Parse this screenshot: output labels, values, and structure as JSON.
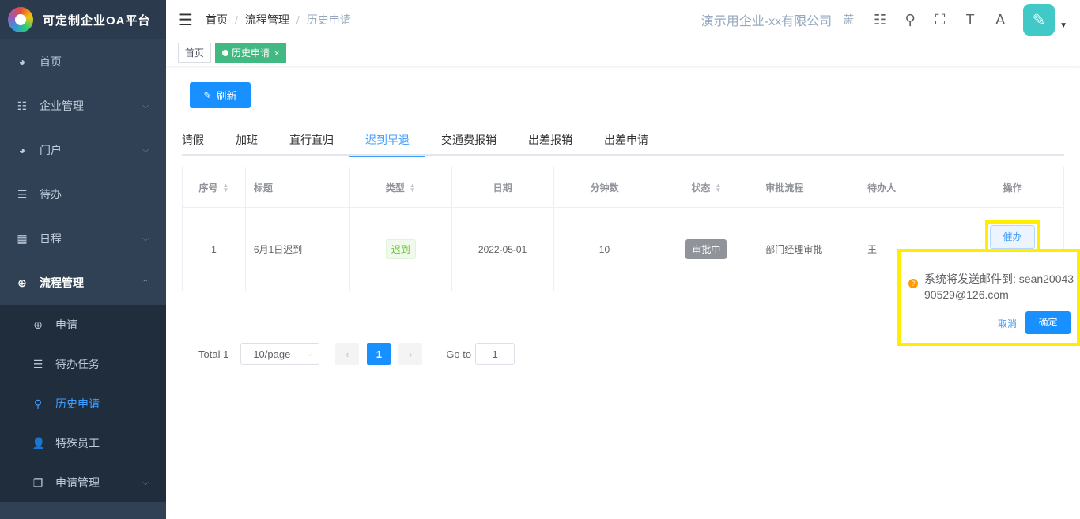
{
  "app": {
    "title": "可定制企业OA平台"
  },
  "sidebar": {
    "items": [
      {
        "label": "首页",
        "icon": "dashboard-icon",
        "glyph": "◕",
        "arrow": ""
      },
      {
        "label": "企业管理",
        "icon": "list-icon",
        "glyph": "☷",
        "arrow": "⌵"
      },
      {
        "label": "门户",
        "icon": "dashboard-icon",
        "glyph": "◕",
        "arrow": "⌵"
      },
      {
        "label": "待办",
        "icon": "list-icon",
        "glyph": "☰",
        "arrow": ""
      },
      {
        "label": "日程",
        "icon": "grid-icon",
        "glyph": "▦",
        "arrow": "⌵"
      },
      {
        "label": "流程管理",
        "icon": "lifebuoy-icon",
        "glyph": "⊕",
        "arrow": "⌃"
      }
    ],
    "subitems": [
      {
        "label": "申请",
        "icon": "lifebuoy-icon",
        "glyph": "⊕"
      },
      {
        "label": "待办任务",
        "icon": "list-icon",
        "glyph": "☰"
      },
      {
        "label": "历史申请",
        "icon": "search-icon",
        "glyph": "⚲"
      },
      {
        "label": "特殊员工",
        "icon": "user-icon",
        "glyph": "👤"
      },
      {
        "label": "申请管理",
        "icon": "copy-icon",
        "glyph": "❐",
        "arrow": "⌵"
      }
    ]
  },
  "navbar": {
    "breadcrumb": [
      "首页",
      "流程管理",
      "历史申请"
    ],
    "separator": "/",
    "company": "演示用企业-xx有限公司",
    "extra": "萧"
  },
  "tags": {
    "home": "首页",
    "active": "历史申请",
    "close": "×"
  },
  "toolbar": {
    "refresh_label": "刷新"
  },
  "tabs": [
    "请假",
    "加班",
    "直行直归",
    "迟到早退",
    "交通费报销",
    "出差报销",
    "出差申请"
  ],
  "table": {
    "headers": [
      "序号",
      "标题",
      "类型",
      "日期",
      "分钟数",
      "状态",
      "审批流程",
      "待办人",
      "操作"
    ],
    "row": {
      "index": "1",
      "title": "6月1日迟到",
      "type": "迟到",
      "date": "2022-05-01",
      "minutes": "10",
      "status": "审批中",
      "flow": "部门经理审批",
      "assignee": "王",
      "action": "催办"
    }
  },
  "popconfirm": {
    "message": "系统将发送邮件到: sean2004390529@126.com",
    "cancel": "取消",
    "confirm": "确定"
  },
  "pagination": {
    "total": "Total 1",
    "page_size": "10/page",
    "current": "1",
    "goto_label": "Go to",
    "goto_value": "1"
  },
  "colors": {
    "sidebar_bg": "#304156",
    "primary": "#1890ff",
    "tag_active": "#42b983",
    "highlight": "#ffee00"
  }
}
